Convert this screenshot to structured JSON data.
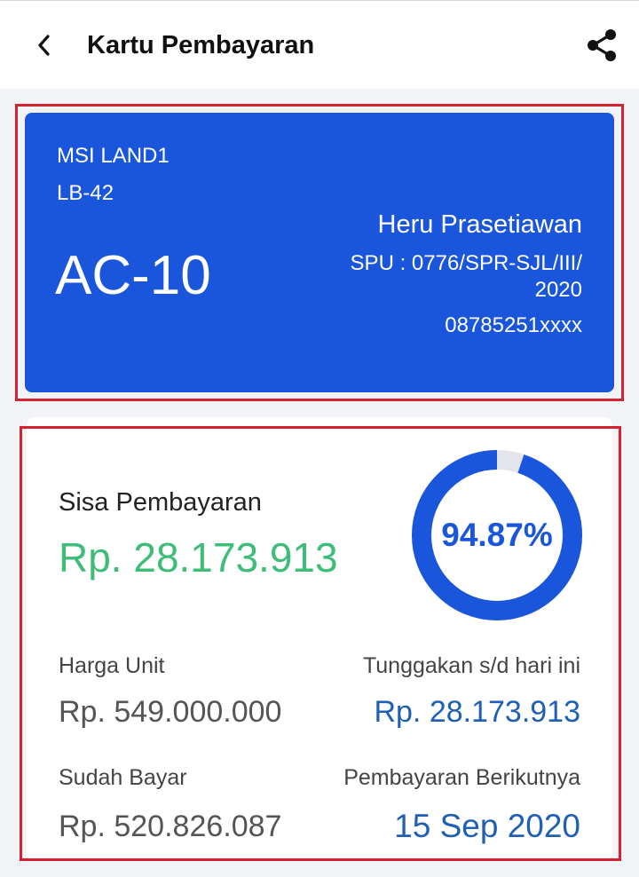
{
  "header": {
    "title": "Kartu Pembayaran",
    "back_icon": "chevron-left-icon",
    "share_icon": "share-icon"
  },
  "unit": {
    "project": "MSI LAND1",
    "block": "LB-42",
    "code": "AC-10",
    "owner": "Heru Prasetiawan",
    "spu": "SPU : 0776/SPR-SJL/III/ 2020",
    "phone": "08785251xxxx"
  },
  "payment": {
    "remaining_label": "Sisa Pembayaran",
    "remaining_value": "Rp. 28.173.913",
    "progress_text": "94.87%",
    "progress_fraction": 0.9487,
    "unit_price_label": "Harga Unit",
    "unit_price_value": "Rp. 549.000.000",
    "arrears_label": "Tunggakan s/d hari ini",
    "arrears_value": "Rp. 28.173.913",
    "paid_label": "Sudah Bayar",
    "paid_value": "Rp. 520.826.087",
    "next_label": "Pembayaran Berikutnya",
    "next_value": "15 Sep 2020"
  },
  "colors": {
    "primary": "#1a56db",
    "remaining": "#3dbd78",
    "value_blue": "#1f5fb5",
    "ring_track": "#e3e5ea",
    "highlight": "#d62230"
  }
}
